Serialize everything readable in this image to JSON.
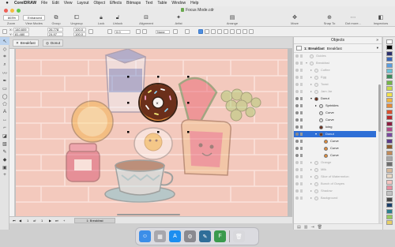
{
  "menubar": {
    "app": "CorelDRAW",
    "items": [
      "File",
      "Edit",
      "View",
      "Layout",
      "Object",
      "Effects",
      "Bitmaps",
      "Text",
      "Table",
      "Window",
      "Help"
    ]
  },
  "window": {
    "title": "Focus Mode.cdr"
  },
  "toolbar": {
    "zoom_value": "803%",
    "view_modes_value": "Enhanced",
    "labels": {
      "zoom": "Zoom",
      "view_modes": "View Modes",
      "group": "Group",
      "ungroup": "Ungroup",
      "lock": "Lock",
      "unlock": "Unlock",
      "alignment": "Alignment",
      "arrange": "Arrange",
      "artist": "Artist",
      "move": "Move",
      "snap_to": "Snap To",
      "dot_more": "Dot more...",
      "inspectors": "Inspectors"
    }
  },
  "propbar": {
    "x": "140.609",
    "y": "81.480",
    "w": "26.778",
    "h": "24.97",
    "scale_x": "100.0",
    "scale_y": "100.0",
    "angle": "0.0",
    "outline": "None"
  },
  "doc_tabs": [
    {
      "label": "Breakfast"
    },
    {
      "label": "Donut"
    }
  ],
  "pagebar": {
    "page_of": "of",
    "page_num": "1",
    "page_tab": "1: Breakfast"
  },
  "docker": {
    "title": "Objects",
    "page_label": "1: Breakfast",
    "page_name": "Breakfast",
    "tree": [
      {
        "label": "Guides",
        "level": 1,
        "dim": true,
        "twisty": ""
      },
      {
        "label": "Breakfast",
        "level": 1,
        "dim": true,
        "twisty": "▾"
      },
      {
        "label": "Coffee",
        "level": 2,
        "dim": true,
        "twisty": "▸"
      },
      {
        "label": "Egg",
        "level": 2,
        "dim": true,
        "twisty": "▸"
      },
      {
        "label": "Toast",
        "level": 2,
        "dim": true,
        "twisty": "▸"
      },
      {
        "label": "Jam Jar",
        "level": 2,
        "dim": true,
        "twisty": "▸"
      },
      {
        "label": "Donut",
        "level": 2,
        "dim": false,
        "twisty": "▾"
      },
      {
        "label": "Sprinkles",
        "level": 3,
        "dim": false,
        "twisty": "▸"
      },
      {
        "label": "Curve",
        "level": 3,
        "dim": false,
        "twisty": ""
      },
      {
        "label": "Curve",
        "level": 3,
        "dim": false,
        "twisty": ""
      },
      {
        "label": "Icing",
        "level": 3,
        "dim": false,
        "twisty": ""
      },
      {
        "label": "Donut",
        "level": 3,
        "dim": false,
        "twisty": "▾",
        "selected": true
      },
      {
        "label": "Curve",
        "level": 4,
        "dim": false,
        "twisty": ""
      },
      {
        "label": "Curve",
        "level": 4,
        "dim": false,
        "twisty": ""
      },
      {
        "label": "Curve",
        "level": 4,
        "dim": false,
        "twisty": ""
      },
      {
        "label": "Orange",
        "level": 2,
        "dim": true,
        "twisty": "▸"
      },
      {
        "label": "Milk",
        "level": 2,
        "dim": true,
        "twisty": "▸"
      },
      {
        "label": "Slice of Watermelon",
        "level": 2,
        "dim": true,
        "twisty": "▸"
      },
      {
        "label": "Bunch of Grapes",
        "level": 2,
        "dim": true,
        "twisty": "▸"
      },
      {
        "label": "Shadow",
        "level": 2,
        "dim": true,
        "twisty": "▸"
      },
      {
        "label": "Background",
        "level": 2,
        "dim": true,
        "twisty": "▸"
      }
    ]
  },
  "palette": {
    "colors": [
      "#ffffff",
      "#000000",
      "#2b2f6b",
      "#3a66b6",
      "#5a9de0",
      "#6cc3d5",
      "#3b8b5a",
      "#74b64a",
      "#c9d94b",
      "#f2e24a",
      "#f1b642",
      "#e58a3a",
      "#d9502d",
      "#b5282d",
      "#8c1d3f",
      "#b04b8a",
      "#7a4aa0",
      "#5a3a86",
      "#8b5a2b",
      "#c08a5a",
      "#a8a8a8",
      "#6e6e6e",
      "#d7b99b",
      "#e9d7c3",
      "#f5c5c0",
      "#e88fa0",
      "#c2c2c2",
      "#474747",
      "#1b3f6a",
      "#2a7f8f",
      "#96c95d",
      "#e6cf67"
    ]
  },
  "dock": {
    "apps": [
      {
        "name": "finder",
        "color": "#3c8ee8",
        "glyph": "☺"
      },
      {
        "name": "launchpad",
        "color": "#a7a7ad",
        "glyph": "▦"
      },
      {
        "name": "app-store",
        "color": "#1c8ef0",
        "glyph": "A"
      },
      {
        "name": "system-preferences",
        "color": "#8a8a90",
        "glyph": "⚙"
      },
      {
        "name": "coreldraw",
        "color": "#2f6e99",
        "glyph": "✎"
      },
      {
        "name": "corel-font-manager",
        "color": "#3a9a4d",
        "glyph": "F"
      },
      {
        "name": "trash",
        "color": "#d8d8dc",
        "glyph": "🗑"
      }
    ]
  },
  "colors": {
    "selection_blue": "#2f6fd6",
    "donut_brown": "#6b3a1f",
    "donut_dough": "#d98a3b",
    "icing": "#6b2f1a"
  }
}
